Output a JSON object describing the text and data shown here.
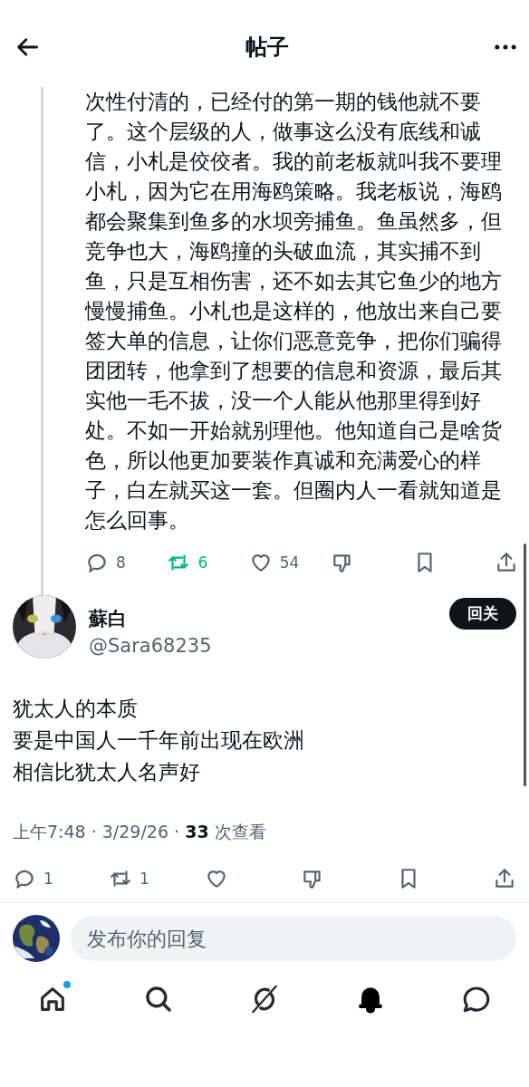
{
  "header": {
    "title": "帖子"
  },
  "parent_post": {
    "text": "次性付清的，已经付的第一期的钱他就不要了。这个层级的人，做事这么没有底线和诚信，小札是佼佼者。我的前老板就叫我不要理小札，因为它在用海鸥策略。我老板说，海鸥都会聚集到鱼多的水坝旁捕鱼。鱼虽然多，但竞争也大，海鸥撞的头破血流，其实捕不到鱼，只是互相伤害，还不如去其它鱼少的地方慢慢捕鱼。小札也是这样的，他放出来自己要签大单的信息，让你们恶意竞争，把你们骗得团团转，他拿到了想要的信息和资源，最后其实他一毛不拔，没一个人能从他那里得到好处。不如一开始就别理他。他知道自己是啥货色，所以他更加要装作真诚和充满爱心的样子，白左就买这一套。但圈内人一看就知道是怎么回事。",
    "actions": [
      {
        "kind": "reply",
        "count": "8",
        "active": false
      },
      {
        "kind": "repost",
        "count": "6",
        "active": true
      },
      {
        "kind": "like",
        "count": "54",
        "active": false
      },
      {
        "kind": "dislike",
        "active": false
      },
      {
        "kind": "bookmark",
        "active": false
      },
      {
        "kind": "share",
        "active": false
      }
    ]
  },
  "post": {
    "name": "蘇白",
    "handle": "@Sara68235",
    "follow_button": "回关",
    "lines": [
      "犹太人的本质",
      "要是中国人一千年前出现在欧洲",
      "相信比犹太人名声好"
    ],
    "meta": {
      "time": "上午7:48 · 3/29/26 · ",
      "views": "33",
      "views_label": " 次查看"
    },
    "actions": [
      {
        "kind": "reply",
        "count": "1",
        "active": false
      },
      {
        "kind": "repost",
        "count": "1",
        "active": false
      },
      {
        "kind": "like",
        "active": false
      },
      {
        "kind": "dislike",
        "active": false
      },
      {
        "kind": "bookmark",
        "active": false
      },
      {
        "kind": "share",
        "active": false
      }
    ]
  },
  "reply_bar": {
    "placeholder": "发布你的回复"
  },
  "nav": [
    {
      "kind": "home",
      "selected": false,
      "dot": true
    },
    {
      "kind": "search",
      "selected": false,
      "dot": false
    },
    {
      "kind": "grok",
      "selected": false,
      "dot": false
    },
    {
      "kind": "notifications",
      "selected": true,
      "dot": false
    },
    {
      "kind": "messages",
      "selected": false,
      "dot": false
    }
  ]
}
